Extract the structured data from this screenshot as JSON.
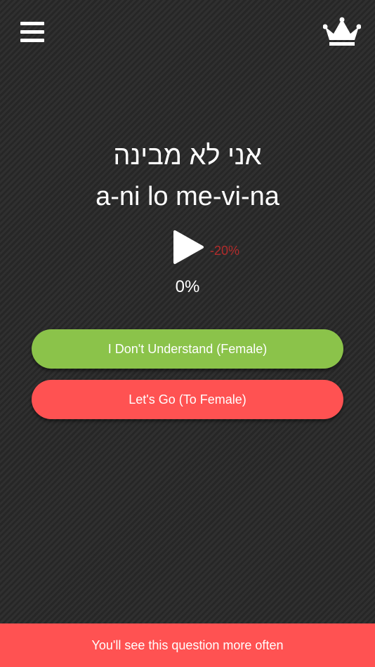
{
  "header": {
    "menu_icon": "hamburger-menu-icon",
    "premium_icon": "crown-icon"
  },
  "phrase": {
    "native": "אני לא מבינה",
    "transliteration": "a-ni lo me-vi-na"
  },
  "audio": {
    "play_icon": "play-icon",
    "speed_label": "-20%",
    "progress": "0%"
  },
  "answers": [
    {
      "label": "I Don't Understand (Female)",
      "color": "#8bc34a"
    },
    {
      "label": "Let's Go (To Female)",
      "color": "#ff5252"
    }
  ],
  "feedback": {
    "message": "You'll see this question more often",
    "color": "#ff5252"
  }
}
